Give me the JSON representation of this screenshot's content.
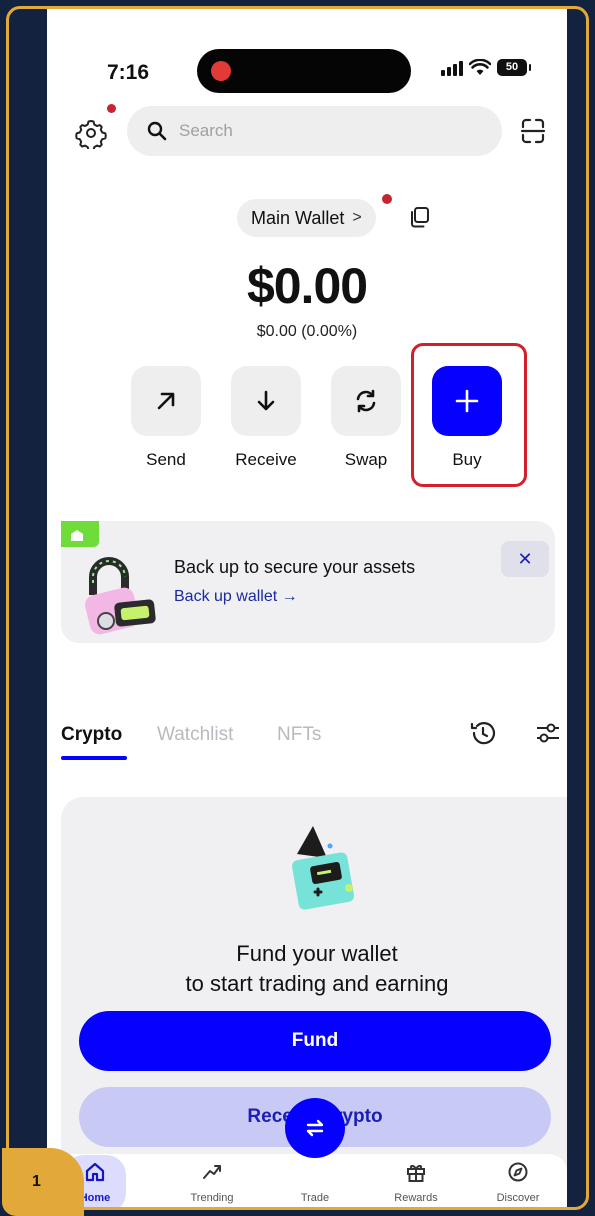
{
  "status_bar": {
    "time": "7:16",
    "battery": "50"
  },
  "header": {
    "search_placeholder": "Search"
  },
  "wallet": {
    "name": "Main Wallet",
    "chevron": ">",
    "balance": "$0.00",
    "change": "$0.00 (0.00%)"
  },
  "actions": [
    {
      "label": "Send",
      "icon": "arrow-up-right-icon"
    },
    {
      "label": "Receive",
      "icon": "arrow-down-icon"
    },
    {
      "label": "Swap",
      "icon": "refresh-icon"
    },
    {
      "label": "Buy",
      "icon": "plus-icon"
    }
  ],
  "banner": {
    "title": "Back up to secure your assets",
    "link": "Back up wallet →",
    "close": "✕"
  },
  "tabs": [
    {
      "label": "Crypto",
      "active": true
    },
    {
      "label": "Watchlist",
      "active": false
    },
    {
      "label": "NFTs",
      "active": false
    }
  ],
  "fund_card": {
    "line1": "Fund your wallet",
    "line2": "to start trading and earning",
    "fund_button": "Fund",
    "receive_button": "Receive crypto"
  },
  "nav": [
    {
      "label": "Home",
      "icon": "home-icon",
      "active": true
    },
    {
      "label": "Trending",
      "icon": "trending-icon",
      "active": false
    },
    {
      "label": "Trade",
      "icon": "swap-arrows-icon",
      "active": false
    },
    {
      "label": "Rewards",
      "icon": "gift-icon",
      "active": false
    },
    {
      "label": "Discover",
      "icon": "compass-icon",
      "active": false
    }
  ],
  "step_badge": "1",
  "colors": {
    "accent": "#0500ff",
    "highlight": "#d21f2b",
    "frame": "#e2a93a",
    "background": "#12223f"
  }
}
